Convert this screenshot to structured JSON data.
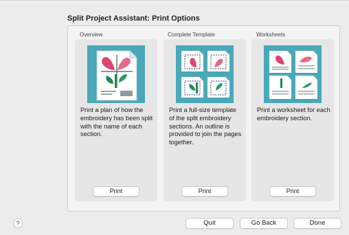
{
  "dialog": {
    "title": "Split Project Assistant: Print Options"
  },
  "sections": [
    {
      "label": "Overview",
      "description": "Print a plan of how the embroidery has been split with the name of each section.",
      "button": "Print",
      "icon": "overview-plan-icon"
    },
    {
      "label": "Complete Template",
      "description": "Print a full-size template of the split embroidery sections. An outline is provided to join the pages together.",
      "button": "Print",
      "icon": "template-pages-icon"
    },
    {
      "label": "Worksheets",
      "description": "Print a worksheet for each embroidery section.",
      "button": "Print",
      "icon": "worksheet-pages-icon"
    }
  ],
  "footer": {
    "help": "?",
    "quit": "Quit",
    "go_back": "Go Back",
    "done": "Done"
  },
  "colors": {
    "thumb_background": "#4aa8b8",
    "petal_pink": "#e0446e",
    "leaf_green": "#1f8a5a",
    "dashed_outline": "#334466"
  }
}
